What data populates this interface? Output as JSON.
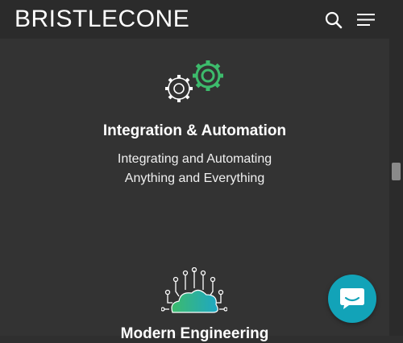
{
  "header": {
    "brand": "BRISTLECONE",
    "search_icon": "search-icon",
    "menu_icon": "hamburger-menu-icon"
  },
  "sections": [
    {
      "icon": "gears-icon",
      "title": "Integration & Automation",
      "description_line1": "Integrating and Automating",
      "description_line2": "Anything and Everything"
    },
    {
      "icon": "cloud-network-icon",
      "title": "Modern Engineering"
    }
  ],
  "chat_widget": {
    "icon": "chat-bubble-icon"
  },
  "colors": {
    "background": "#333333",
    "header": "#2b2b2b",
    "accent_green": "#3dbb6c",
    "chat_teal": "#12a3b8"
  }
}
